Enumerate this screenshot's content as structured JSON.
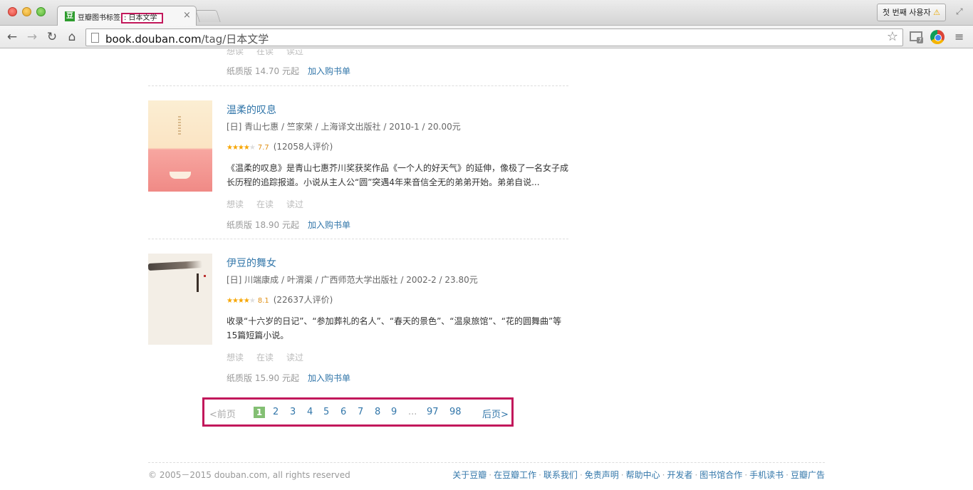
{
  "browser": {
    "tab": {
      "favicon": "豆",
      "title_prefix": "豆瓣图书标签",
      "title_highlight": ": 日本文学",
      "close": "×"
    },
    "profile_button": {
      "label": "첫 번째 사용자",
      "warning_icon": "⚠"
    },
    "nav": {
      "back": "←",
      "forward": "→",
      "reload": "↻",
      "home": "⌂"
    },
    "url": {
      "host": "book.douban.com",
      "path": "/tag/日本文学"
    },
    "star": "☆",
    "gmail_badge": "7",
    "menu": "≡"
  },
  "top_cut_item": {
    "actions": [
      "想读",
      "在读",
      "读过"
    ],
    "price": "纸质版 14.70 元起",
    "cart": "加入购书单"
  },
  "books": [
    {
      "title": "温柔的叹息",
      "pub": "[日] 青山七惠 / 竺家荣 / 上海译文出版社 / 2010-1 / 20.00元",
      "rating": 7.7,
      "rating_text": "7.7",
      "stars_filled": 4,
      "count": "(12058人评价)",
      "desc": "《温柔的叹息》是青山七惠芥川奖获奖作品《一个人的好天气》的延伸，像极了一名女子成长历程的追踪报道。小说从主人公“圆”突遇4年来音信全无的弟弟开始。弟弟自说...",
      "actions": [
        "想读",
        "在读",
        "读过"
      ],
      "price": "纸质版 18.90 元起",
      "cart": "加入购书单"
    },
    {
      "title": "伊豆的舞女",
      "pub": "[日] 川端康成 / 叶渭渠 / 广西师范大学出版社 / 2002-2 / 23.80元",
      "rating": 8.1,
      "rating_text": "8.1",
      "stars_filled": 4,
      "count": "(22637人评价)",
      "desc": "收录“十六岁的日记”、“参加葬礼的名人”、“春天的景色”、“温泉旅馆”、“花的圆舞曲”等15篇短篇小说。",
      "actions": [
        "想读",
        "在读",
        "读过"
      ],
      "price": "纸质版 15.90 元起",
      "cart": "加入购书单"
    }
  ],
  "pagination": {
    "prev": "<前页",
    "current": "1",
    "pages": [
      "2",
      "3",
      "4",
      "5",
      "6",
      "7",
      "8",
      "9"
    ],
    "ellipsis": "...",
    "tail": [
      "97",
      "98"
    ],
    "next": "后页>"
  },
  "footer": {
    "copyright": "© 2005－2015 douban.com, all rights reserved",
    "links": [
      "关于豆瓣",
      "在豆瓣工作",
      "联系我们",
      "免责声明",
      "帮助中心",
      "开发者",
      "图书馆合作",
      "手机读书",
      "豆瓣广告"
    ]
  },
  "colors": {
    "link": "#3377aa",
    "highlight_border": "#c2185b",
    "current_page": "#83bf73",
    "star": "#f7a600"
  }
}
